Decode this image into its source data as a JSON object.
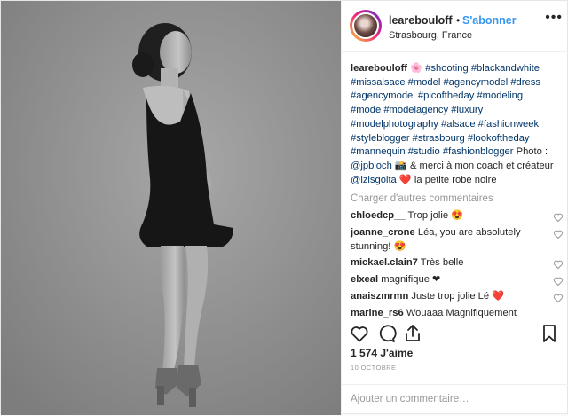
{
  "header": {
    "username": "learebouloff",
    "separator": "•",
    "follow_label": "S'abonner",
    "location": "Strasbourg, France",
    "more_icon": "more-options-icon"
  },
  "caption": {
    "username": "learebouloff",
    "flower": "🌸",
    "hashtags_1": "#shooting #blackandwhite #missalsace #model #agencymodel #dress #agencymodel #picoftheday #modeling #mode #modelagency #luxury #modelphotography #alsace #fashionweek #styleblogger #strasbourg #lookoftheday #mannequin #studio #fashionblogger",
    "text_1": "Photo : ",
    "mention_1": "@jpbloch",
    "camera": "📸",
    "text_2": " & merci à mon coach et créateur ",
    "mention_2": "@izisgoita",
    "heart": "❤️",
    "text_3": " la petite robe noire"
  },
  "load_more_label": "Charger d'autres commentaires",
  "comments": [
    {
      "user": "chloedcp__",
      "text": "Trop jolie 😍"
    },
    {
      "user": "joanne_crone",
      "text": "Léa, you are absolutely stunning! 😍"
    },
    {
      "user": "mickael.clain7",
      "text": "Très belle"
    },
    {
      "user": "elxeal",
      "text": "magnifique ❤"
    },
    {
      "user": "anaiszmrmn",
      "text": "Juste trop jolie Lé ❤️"
    },
    {
      "user": "marine_rs6",
      "text": "Wouaaa Magnifiquement"
    }
  ],
  "actions": {
    "likes": "1 574 J'aime",
    "date": "10 OCTOBRE",
    "comment_placeholder": "Ajouter un commentaire…"
  },
  "colors": {
    "accent": "#3897f0",
    "hashtag": "#003569",
    "muted": "#999999",
    "text": "#262626"
  }
}
